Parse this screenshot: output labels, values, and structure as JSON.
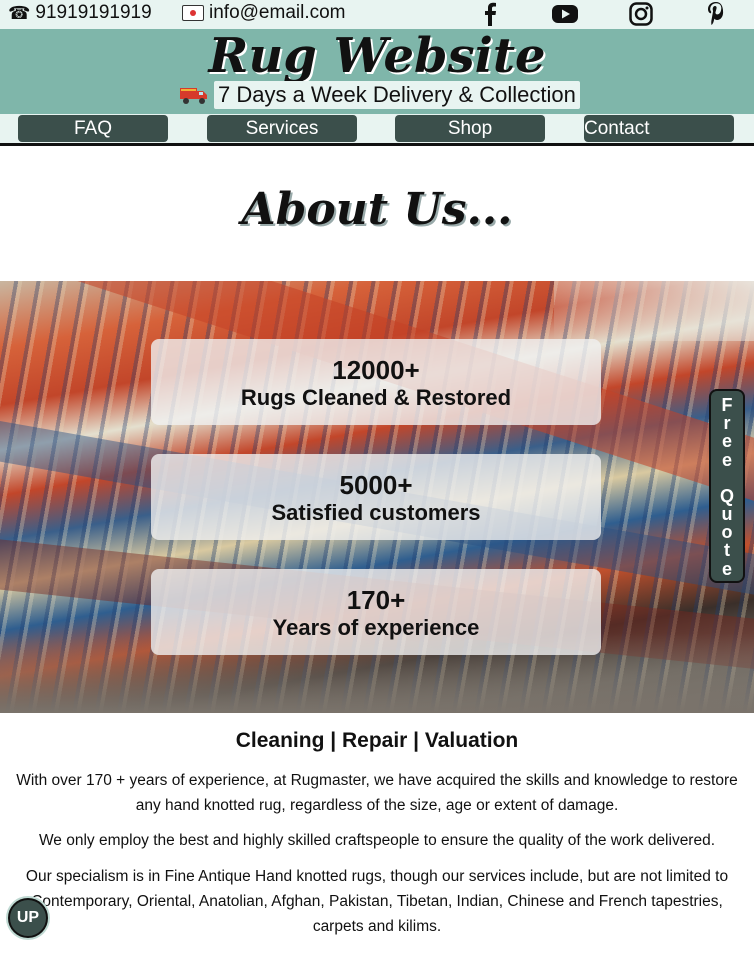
{
  "topbar": {
    "phone": "91919191919",
    "email": "info@email.com",
    "social": [
      {
        "name": "facebook",
        "icon": "facebook-icon"
      },
      {
        "name": "youtube",
        "icon": "youtube-icon"
      },
      {
        "name": "instagram",
        "icon": "instagram-icon"
      },
      {
        "name": "pinterest",
        "icon": "pinterest-icon"
      }
    ]
  },
  "header": {
    "title": "Rug Website",
    "delivery": "7 Days a Week Delivery & Collection"
  },
  "nav": {
    "items": [
      "FAQ",
      "Services",
      "Shop",
      "Contact"
    ]
  },
  "about": {
    "heading": "About Us..."
  },
  "stats": [
    {
      "number": "12000+",
      "label": "Rugs Cleaned & Restored"
    },
    {
      "number": "5000+",
      "label": "Satisfied customers"
    },
    {
      "number": "170+",
      "label": "Years of experience"
    }
  ],
  "quote_tab": {
    "line1": "Free",
    "line2": "Quote"
  },
  "services": {
    "title": "Cleaning | Repair | Valuation",
    "paragraphs": [
      "With over 170 + years of experience, at Rugmaster, we have acquired the skills and knowledge to restore any hand knotted rug, regardless of the size, age or extent of damage.",
      "We only employ the best and highly skilled craftspeople to ensure the quality of the work delivered.",
      "Our specialism is in Fine Antique Hand knotted rugs, though our services include, but are not limited to Contemporary, Oriental, Anatolian, Afghan, Pakistan, Tibetan, Indian, Chinese and French tapestries, carpets and kilims."
    ]
  },
  "up_button": {
    "label": "UP"
  },
  "colors": {
    "header_bg": "#7fb6aa",
    "bar_bg": "#e8f4f1",
    "button_bg": "#3b4f4b"
  }
}
